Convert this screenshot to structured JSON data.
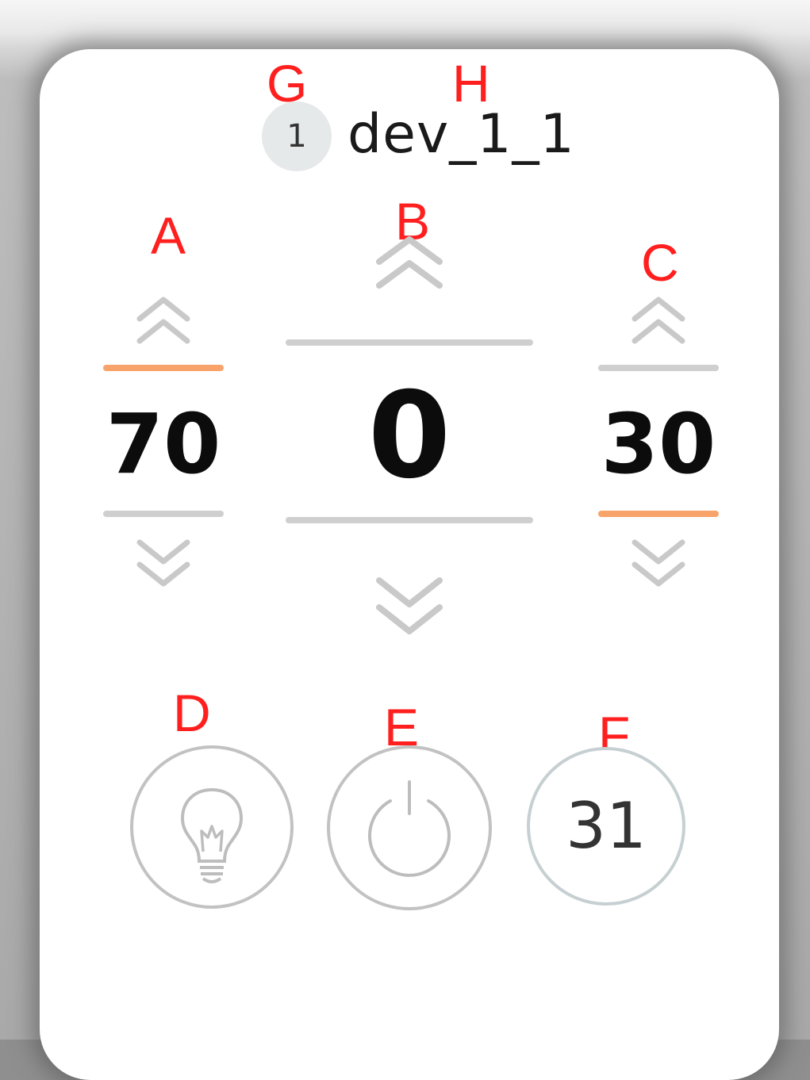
{
  "device": {
    "index": "1",
    "name": "dev_1_1"
  },
  "annotations": {
    "a": "A",
    "b": "B",
    "c": "C",
    "d": "D",
    "e": "E",
    "f": "F",
    "g": "G",
    "h": "H"
  },
  "controls": {
    "left": {
      "value": "70",
      "highlight": "top"
    },
    "center": {
      "value": "0",
      "highlight": "none"
    },
    "right": {
      "value": "30",
      "highlight": "bottom"
    }
  },
  "buttons": {
    "light_icon": "lightbulb-icon",
    "power_icon": "power-icon",
    "timer_value": "31"
  },
  "colors": {
    "accent": "#f7a36a",
    "divider": "#cfcfcf",
    "annotation": "#ff1f1f",
    "badge_bg": "#e5e9e9"
  }
}
